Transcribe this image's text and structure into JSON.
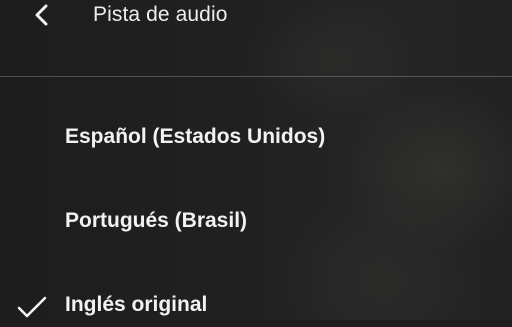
{
  "header": {
    "title": "Pista de audio",
    "back_icon": "chevron-left-icon"
  },
  "audio_tracks": [
    {
      "label": "Español (Estados Unidos)",
      "selected": false
    },
    {
      "label": "Portugués (Brasil)",
      "selected": false
    },
    {
      "label": "Inglés original",
      "selected": true
    }
  ],
  "colors": {
    "text": "#f2f2f2",
    "divider": "rgba(255,255,255,0.22)",
    "overlay": "rgba(28,28,28,0.55)"
  }
}
